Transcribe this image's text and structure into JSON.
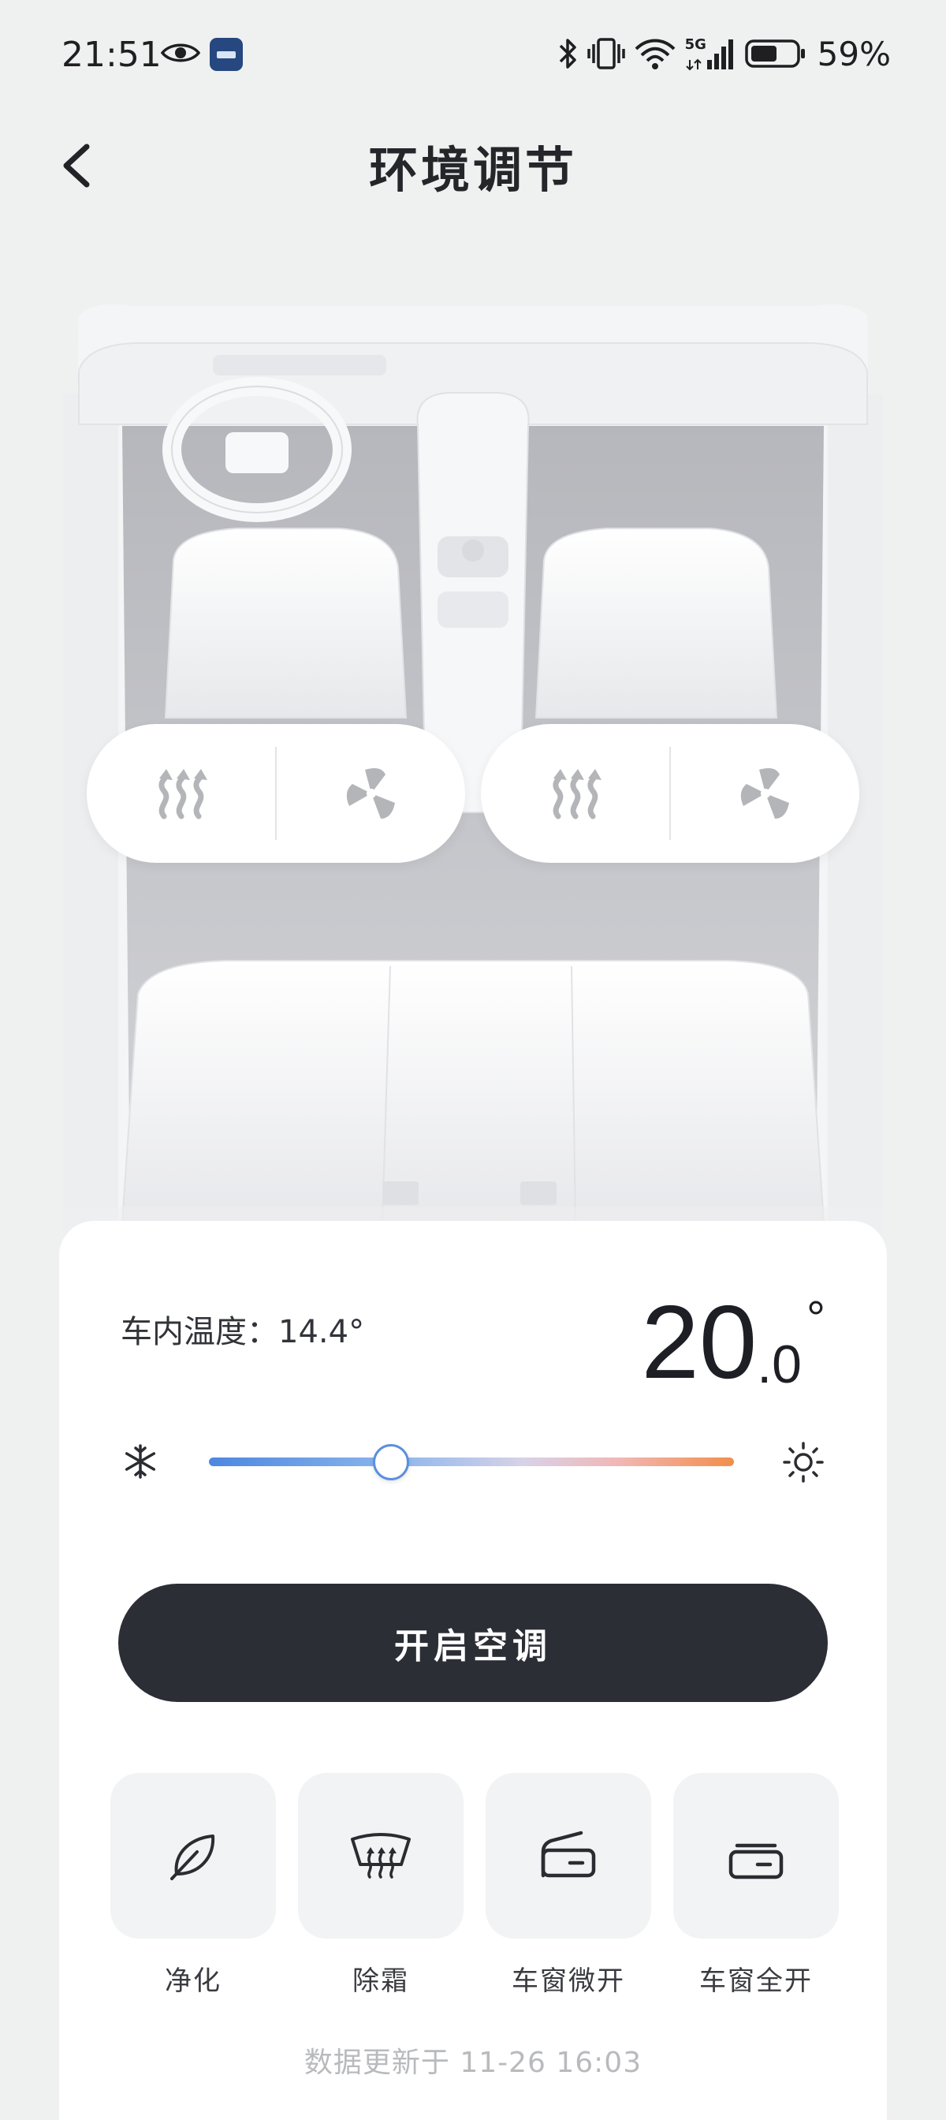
{
  "status_bar": {
    "time": "21:51",
    "network": "5G",
    "battery": "59%",
    "battery_level": 0.59,
    "icons": [
      "eye-icon",
      "app-notification-icon",
      "bluetooth-icon",
      "vibrate-icon",
      "wifi-icon",
      "cellular-signal-icon",
      "battery-icon"
    ]
  },
  "header": {
    "back_icon": "chevron-left-icon",
    "title": "环境调节"
  },
  "seats": {
    "left": {
      "heat_icon": "seat-heat-icon",
      "vent_icon": "seat-ventilation-icon"
    },
    "right": {
      "heat_icon": "seat-heat-icon",
      "vent_icon": "seat-ventilation-icon"
    }
  },
  "climate": {
    "indoor_label": "车内温度：",
    "indoor_value": "14.4°",
    "target_integer": "20",
    "target_decimal": ".0",
    "target_unit": "°",
    "slider_level": 0.345,
    "cold_icon": "snowflake-icon",
    "hot_icon": "sun-icon",
    "ac_button": "开启空调"
  },
  "quick_actions": [
    {
      "label": "净化",
      "icon": "leaf-icon"
    },
    {
      "label": "除霜",
      "icon": "defrost-icon"
    },
    {
      "label": "车窗微开",
      "icon": "window-partial-open-icon"
    },
    {
      "label": "车窗全开",
      "icon": "window-full-open-icon"
    }
  ],
  "update_info": "数据更新于 11-26 16:03",
  "colors": {
    "background": "#eff0f0",
    "button_dark": "#2c2e36",
    "slider_cold": "#4d87e0",
    "slider_hot": "#f28e4a"
  }
}
